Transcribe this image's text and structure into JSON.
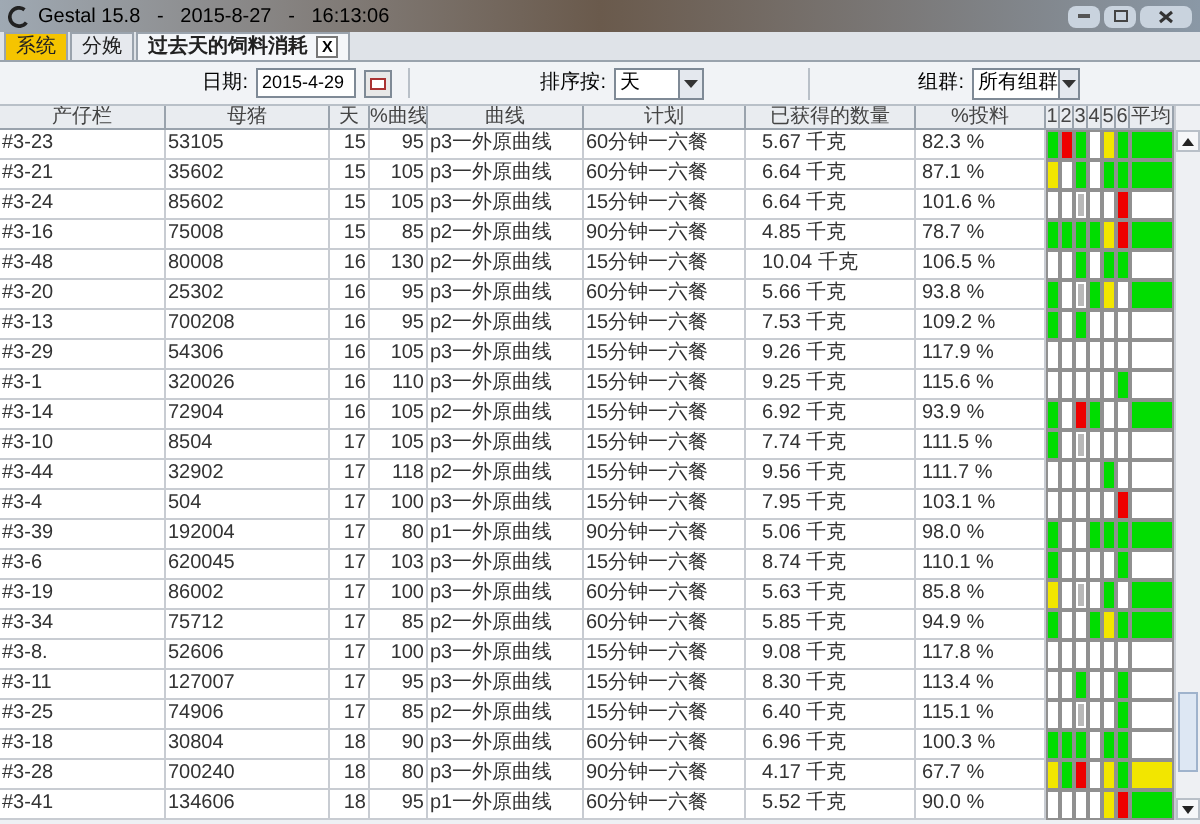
{
  "window": {
    "title": "Gestal 15.8   -   2015-8-27   -   16:13:06"
  },
  "tabs": [
    {
      "label": "系统",
      "selected": false,
      "highlighted": true
    },
    {
      "label": "分娩",
      "selected": false,
      "highlighted": false
    },
    {
      "label": "过去天的饲料消耗",
      "selected": true,
      "highlighted": false,
      "close_label": "X"
    }
  ],
  "filters": {
    "date_label": "日期:",
    "date_value": "2015-4-29",
    "sort_label": "排序按:",
    "sort_value": "天",
    "group_label": "组群:",
    "group_value": "所有组群"
  },
  "table": {
    "columns": [
      "产仔栏",
      "母猪",
      "天",
      "%曲线",
      "曲线",
      "计划",
      "已获得的数量",
      "%投料",
      "1",
      "2",
      "3",
      "4",
      "5",
      "6",
      "平均"
    ],
    "rows": [
      {
        "pen": "#3-23",
        "sow": "53105",
        "day": "15",
        "curve_pct": "95",
        "curve": "p3一外原曲线",
        "plan": "60分钟一六餐",
        "amount": "5.67 千克",
        "feed_pct": "82.3 %",
        "cells": [
          {
            "kind": "fill",
            "color": "#00dd00"
          },
          {
            "kind": "fill",
            "color": "#ee0000"
          },
          {
            "kind": "fill",
            "color": "#00dd00"
          },
          {
            "kind": "fill",
            "color": "#ffffff"
          },
          {
            "kind": "fill",
            "color": "#f2e600"
          },
          {
            "kind": "fill",
            "color": "#00dd00"
          },
          {
            "kind": "fill",
            "color": "#00dd00"
          }
        ]
      },
      {
        "pen": "#3-21",
        "sow": "35602",
        "day": "15",
        "curve_pct": "105",
        "curve": "p3一外原曲线",
        "plan": "60分钟一六餐",
        "amount": "6.64 千克",
        "feed_pct": "87.1 %",
        "cells": [
          {
            "kind": "fill",
            "color": "#f2e600"
          },
          {
            "kind": "fill",
            "color": "#ffffff"
          },
          {
            "kind": "fill",
            "color": "#00dd00"
          },
          {
            "kind": "fill",
            "color": "#ffffff"
          },
          {
            "kind": "fill",
            "color": "#00dd00"
          },
          {
            "kind": "fill",
            "color": "#00dd00"
          },
          {
            "kind": "fill",
            "color": "#00dd00"
          }
        ]
      },
      {
        "pen": "#3-24",
        "sow": "85602",
        "day": "15",
        "curve_pct": "105",
        "curve": "p3一外原曲线",
        "plan": "15分钟一六餐",
        "amount": "6.64 千克",
        "feed_pct": "101.6 %",
        "cells": [
          {
            "kind": "fill",
            "color": "#ffffff"
          },
          {
            "kind": "fill",
            "color": "#ffffff"
          },
          {
            "kind": "bar",
            "color": "#b8b8b8"
          },
          {
            "kind": "fill",
            "color": "#ffffff"
          },
          {
            "kind": "fill",
            "color": "#ffffff"
          },
          {
            "kind": "fill",
            "color": "#ee0000"
          },
          {
            "kind": "fill",
            "color": "#ffffff"
          }
        ]
      },
      {
        "pen": "#3-16",
        "sow": "75008",
        "day": "15",
        "curve_pct": "85",
        "curve": "p2一外原曲线",
        "plan": "90分钟一六餐",
        "amount": "4.85 千克",
        "feed_pct": "78.7 %",
        "cells": [
          {
            "kind": "fill",
            "color": "#00dd00"
          },
          {
            "kind": "fill",
            "color": "#00dd00"
          },
          {
            "kind": "fill",
            "color": "#00dd00"
          },
          {
            "kind": "fill",
            "color": "#00dd00"
          },
          {
            "kind": "fill",
            "color": "#f2e600"
          },
          {
            "kind": "fill",
            "color": "#ee0000"
          },
          {
            "kind": "fill",
            "color": "#00dd00"
          }
        ]
      },
      {
        "pen": "#3-48",
        "sow": "80008",
        "day": "16",
        "curve_pct": "130",
        "curve": "p2一外原曲线",
        "plan": "15分钟一六餐",
        "amount": "10.04 千克",
        "feed_pct": "106.5 %",
        "cells": [
          {
            "kind": "fill",
            "color": "#ffffff"
          },
          {
            "kind": "fill",
            "color": "#ffffff"
          },
          {
            "kind": "fill",
            "color": "#00dd00"
          },
          {
            "kind": "fill",
            "color": "#ffffff"
          },
          {
            "kind": "fill",
            "color": "#00dd00"
          },
          {
            "kind": "fill",
            "color": "#00dd00"
          },
          {
            "kind": "fill",
            "color": "#ffffff"
          }
        ]
      },
      {
        "pen": "#3-20",
        "sow": "25302",
        "day": "16",
        "curve_pct": "95",
        "curve": "p3一外原曲线",
        "plan": "60分钟一六餐",
        "amount": "5.66 千克",
        "feed_pct": "93.8 %",
        "cells": [
          {
            "kind": "fill",
            "color": "#00dd00"
          },
          {
            "kind": "fill",
            "color": "#ffffff"
          },
          {
            "kind": "bar",
            "color": "#b8b8b8"
          },
          {
            "kind": "fill",
            "color": "#00dd00"
          },
          {
            "kind": "fill",
            "color": "#f2e600"
          },
          {
            "kind": "fill",
            "color": "#ffffff"
          },
          {
            "kind": "fill",
            "color": "#00dd00"
          }
        ]
      },
      {
        "pen": "#3-13",
        "sow": "700208",
        "day": "16",
        "curve_pct": "95",
        "curve": "p2一外原曲线",
        "plan": "15分钟一六餐",
        "amount": "7.53 千克",
        "feed_pct": "109.2 %",
        "cells": [
          {
            "kind": "fill",
            "color": "#00dd00"
          },
          {
            "kind": "fill",
            "color": "#ffffff"
          },
          {
            "kind": "fill",
            "color": "#00dd00"
          },
          {
            "kind": "fill",
            "color": "#ffffff"
          },
          {
            "kind": "fill",
            "color": "#ffffff"
          },
          {
            "kind": "fill",
            "color": "#ffffff"
          },
          {
            "kind": "fill",
            "color": "#ffffff"
          }
        ]
      },
      {
        "pen": "#3-29",
        "sow": "54306",
        "day": "16",
        "curve_pct": "105",
        "curve": "p3一外原曲线",
        "plan": "15分钟一六餐",
        "amount": "9.26 千克",
        "feed_pct": "117.9 %",
        "cells": [
          {
            "kind": "fill",
            "color": "#ffffff"
          },
          {
            "kind": "fill",
            "color": "#ffffff"
          },
          {
            "kind": "fill",
            "color": "#ffffff"
          },
          {
            "kind": "fill",
            "color": "#ffffff"
          },
          {
            "kind": "fill",
            "color": "#ffffff"
          },
          {
            "kind": "fill",
            "color": "#ffffff"
          },
          {
            "kind": "fill",
            "color": "#ffffff"
          }
        ]
      },
      {
        "pen": "#3-1",
        "sow": "320026",
        "day": "16",
        "curve_pct": "110",
        "curve": "p3一外原曲线",
        "plan": "15分钟一六餐",
        "amount": "9.25 千克",
        "feed_pct": "115.6 %",
        "cells": [
          {
            "kind": "fill",
            "color": "#ffffff"
          },
          {
            "kind": "fill",
            "color": "#ffffff"
          },
          {
            "kind": "fill",
            "color": "#ffffff"
          },
          {
            "kind": "fill",
            "color": "#ffffff"
          },
          {
            "kind": "fill",
            "color": "#ffffff"
          },
          {
            "kind": "fill",
            "color": "#00dd00"
          },
          {
            "kind": "fill",
            "color": "#ffffff"
          }
        ]
      },
      {
        "pen": "#3-14",
        "sow": "72904",
        "day": "16",
        "curve_pct": "105",
        "curve": "p2一外原曲线",
        "plan": "15分钟一六餐",
        "amount": "6.92 千克",
        "feed_pct": "93.9 %",
        "cells": [
          {
            "kind": "fill",
            "color": "#00dd00"
          },
          {
            "kind": "fill",
            "color": "#ffffff"
          },
          {
            "kind": "fill",
            "color": "#ee0000"
          },
          {
            "kind": "fill",
            "color": "#00dd00"
          },
          {
            "kind": "fill",
            "color": "#ffffff"
          },
          {
            "kind": "fill",
            "color": "#ffffff"
          },
          {
            "kind": "fill",
            "color": "#00dd00"
          }
        ]
      },
      {
        "pen": "#3-10",
        "sow": "8504",
        "day": "17",
        "curve_pct": "105",
        "curve": "p3一外原曲线",
        "plan": "15分钟一六餐",
        "amount": "7.74 千克",
        "feed_pct": "111.5 %",
        "cells": [
          {
            "kind": "fill",
            "color": "#00dd00"
          },
          {
            "kind": "fill",
            "color": "#ffffff"
          },
          {
            "kind": "bar",
            "color": "#b8b8b8"
          },
          {
            "kind": "fill",
            "color": "#ffffff"
          },
          {
            "kind": "fill",
            "color": "#ffffff"
          },
          {
            "kind": "fill",
            "color": "#ffffff"
          },
          {
            "kind": "fill",
            "color": "#ffffff"
          }
        ]
      },
      {
        "pen": "#3-44",
        "sow": "32902",
        "day": "17",
        "curve_pct": "118",
        "curve": "p2一外原曲线",
        "plan": "15分钟一六餐",
        "amount": "9.56 千克",
        "feed_pct": "111.7 %",
        "cells": [
          {
            "kind": "fill",
            "color": "#ffffff"
          },
          {
            "kind": "fill",
            "color": "#ffffff"
          },
          {
            "kind": "fill",
            "color": "#ffffff"
          },
          {
            "kind": "fill",
            "color": "#ffffff"
          },
          {
            "kind": "fill",
            "color": "#00dd00"
          },
          {
            "kind": "fill",
            "color": "#ffffff"
          },
          {
            "kind": "fill",
            "color": "#ffffff"
          }
        ]
      },
      {
        "pen": "#3-4",
        "sow": "504",
        "day": "17",
        "curve_pct": "100",
        "curve": "p3一外原曲线",
        "plan": "15分钟一六餐",
        "amount": "7.95 千克",
        "feed_pct": "103.1 %",
        "cells": [
          {
            "kind": "fill",
            "color": "#ffffff"
          },
          {
            "kind": "fill",
            "color": "#ffffff"
          },
          {
            "kind": "fill",
            "color": "#ffffff"
          },
          {
            "kind": "fill",
            "color": "#ffffff"
          },
          {
            "kind": "fill",
            "color": "#ffffff"
          },
          {
            "kind": "fill",
            "color": "#ee0000"
          },
          {
            "kind": "fill",
            "color": "#ffffff"
          }
        ]
      },
      {
        "pen": "#3-39",
        "sow": "192004",
        "day": "17",
        "curve_pct": "80",
        "curve": "p1一外原曲线",
        "plan": "90分钟一六餐",
        "amount": "5.06 千克",
        "feed_pct": "98.0 %",
        "cells": [
          {
            "kind": "fill",
            "color": "#00dd00"
          },
          {
            "kind": "fill",
            "color": "#ffffff"
          },
          {
            "kind": "fill",
            "color": "#ffffff"
          },
          {
            "kind": "fill",
            "color": "#00dd00"
          },
          {
            "kind": "fill",
            "color": "#00dd00"
          },
          {
            "kind": "fill",
            "color": "#00dd00"
          },
          {
            "kind": "fill",
            "color": "#00dd00"
          }
        ]
      },
      {
        "pen": "#3-6",
        "sow": "620045",
        "day": "17",
        "curve_pct": "103",
        "curve": "p3一外原曲线",
        "plan": "15分钟一六餐",
        "amount": "8.74 千克",
        "feed_pct": "110.1 %",
        "cells": [
          {
            "kind": "fill",
            "color": "#00dd00"
          },
          {
            "kind": "fill",
            "color": "#ffffff"
          },
          {
            "kind": "fill",
            "color": "#ffffff"
          },
          {
            "kind": "fill",
            "color": "#ffffff"
          },
          {
            "kind": "fill",
            "color": "#ffffff"
          },
          {
            "kind": "fill",
            "color": "#00dd00"
          },
          {
            "kind": "fill",
            "color": "#ffffff"
          }
        ]
      },
      {
        "pen": "#3-19",
        "sow": "86002",
        "day": "17",
        "curve_pct": "100",
        "curve": "p3一外原曲线",
        "plan": "60分钟一六餐",
        "amount": "5.63 千克",
        "feed_pct": "85.8 %",
        "cells": [
          {
            "kind": "fill",
            "color": "#f2e600"
          },
          {
            "kind": "fill",
            "color": "#ffffff"
          },
          {
            "kind": "bar",
            "color": "#b8b8b8"
          },
          {
            "kind": "fill",
            "color": "#ffffff"
          },
          {
            "kind": "fill",
            "color": "#00dd00"
          },
          {
            "kind": "fill",
            "color": "#ffffff"
          },
          {
            "kind": "fill",
            "color": "#00dd00"
          }
        ]
      },
      {
        "pen": "#3-34",
        "sow": "75712",
        "day": "17",
        "curve_pct": "85",
        "curve": "p2一外原曲线",
        "plan": "60分钟一六餐",
        "amount": "5.85 千克",
        "feed_pct": "94.9 %",
        "cells": [
          {
            "kind": "fill",
            "color": "#00dd00"
          },
          {
            "kind": "fill",
            "color": "#ffffff"
          },
          {
            "kind": "fill",
            "color": "#ffffff"
          },
          {
            "kind": "fill",
            "color": "#00dd00"
          },
          {
            "kind": "fill",
            "color": "#f2e600"
          },
          {
            "kind": "fill",
            "color": "#00dd00"
          },
          {
            "kind": "fill",
            "color": "#00dd00"
          }
        ]
      },
      {
        "pen": "#3-8.",
        "sow": "52606",
        "day": "17",
        "curve_pct": "100",
        "curve": "p3一外原曲线",
        "plan": "15分钟一六餐",
        "amount": "9.08 千克",
        "feed_pct": "117.8 %",
        "cells": [
          {
            "kind": "fill",
            "color": "#ffffff"
          },
          {
            "kind": "fill",
            "color": "#ffffff"
          },
          {
            "kind": "fill",
            "color": "#ffffff"
          },
          {
            "kind": "fill",
            "color": "#ffffff"
          },
          {
            "kind": "fill",
            "color": "#ffffff"
          },
          {
            "kind": "fill",
            "color": "#ffffff"
          },
          {
            "kind": "fill",
            "color": "#ffffff"
          }
        ]
      },
      {
        "pen": "#3-11",
        "sow": "127007",
        "day": "17",
        "curve_pct": "95",
        "curve": "p3一外原曲线",
        "plan": "15分钟一六餐",
        "amount": "8.30 千克",
        "feed_pct": "113.4 %",
        "cells": [
          {
            "kind": "fill",
            "color": "#ffffff"
          },
          {
            "kind": "fill",
            "color": "#ffffff"
          },
          {
            "kind": "fill",
            "color": "#00dd00"
          },
          {
            "kind": "fill",
            "color": "#ffffff"
          },
          {
            "kind": "fill",
            "color": "#ffffff"
          },
          {
            "kind": "fill",
            "color": "#00dd00"
          },
          {
            "kind": "fill",
            "color": "#ffffff"
          }
        ]
      },
      {
        "pen": "#3-25",
        "sow": "74906",
        "day": "17",
        "curve_pct": "85",
        "curve": "p2一外原曲线",
        "plan": "15分钟一六餐",
        "amount": "6.40 千克",
        "feed_pct": "115.1 %",
        "cells": [
          {
            "kind": "fill",
            "color": "#ffffff"
          },
          {
            "kind": "fill",
            "color": "#ffffff"
          },
          {
            "kind": "bar",
            "color": "#b8b8b8"
          },
          {
            "kind": "fill",
            "color": "#ffffff"
          },
          {
            "kind": "fill",
            "color": "#ffffff"
          },
          {
            "kind": "fill",
            "color": "#00dd00"
          },
          {
            "kind": "fill",
            "color": "#ffffff"
          }
        ]
      },
      {
        "pen": "#3-18",
        "sow": "30804",
        "day": "18",
        "curve_pct": "90",
        "curve": "p3一外原曲线",
        "plan": "60分钟一六餐",
        "amount": "6.96 千克",
        "feed_pct": "100.3 %",
        "cells": [
          {
            "kind": "fill",
            "color": "#00dd00"
          },
          {
            "kind": "fill",
            "color": "#00dd00"
          },
          {
            "kind": "fill",
            "color": "#00dd00"
          },
          {
            "kind": "fill",
            "color": "#ffffff"
          },
          {
            "kind": "fill",
            "color": "#00dd00"
          },
          {
            "kind": "fill",
            "color": "#00dd00"
          },
          {
            "kind": "fill",
            "color": "#ffffff"
          }
        ]
      },
      {
        "pen": "#3-28",
        "sow": "700240",
        "day": "18",
        "curve_pct": "80",
        "curve": "p3一外原曲线",
        "plan": "90分钟一六餐",
        "amount": "4.17 千克",
        "feed_pct": "67.7 %",
        "cells": [
          {
            "kind": "fill",
            "color": "#f2e600"
          },
          {
            "kind": "fill",
            "color": "#00dd00"
          },
          {
            "kind": "fill",
            "color": "#ee0000"
          },
          {
            "kind": "fill",
            "color": "#ffffff"
          },
          {
            "kind": "fill",
            "color": "#f2e600"
          },
          {
            "kind": "fill",
            "color": "#00dd00"
          },
          {
            "kind": "fill",
            "color": "#f2e600"
          }
        ]
      },
      {
        "pen": "#3-41",
        "sow": "134606",
        "day": "18",
        "curve_pct": "95",
        "curve": "p1一外原曲线",
        "plan": "60分钟一六餐",
        "amount": "5.52 千克",
        "feed_pct": "90.0 %",
        "cells": [
          {
            "kind": "fill",
            "color": "#ffffff"
          },
          {
            "kind": "fill",
            "color": "#ffffff"
          },
          {
            "kind": "fill",
            "color": "#ffffff"
          },
          {
            "kind": "fill",
            "color": "#ffffff"
          },
          {
            "kind": "fill",
            "color": "#f2e600"
          },
          {
            "kind": "fill",
            "color": "#ee0000"
          },
          {
            "kind": "fill",
            "color": "#00dd00"
          }
        ]
      }
    ]
  }
}
